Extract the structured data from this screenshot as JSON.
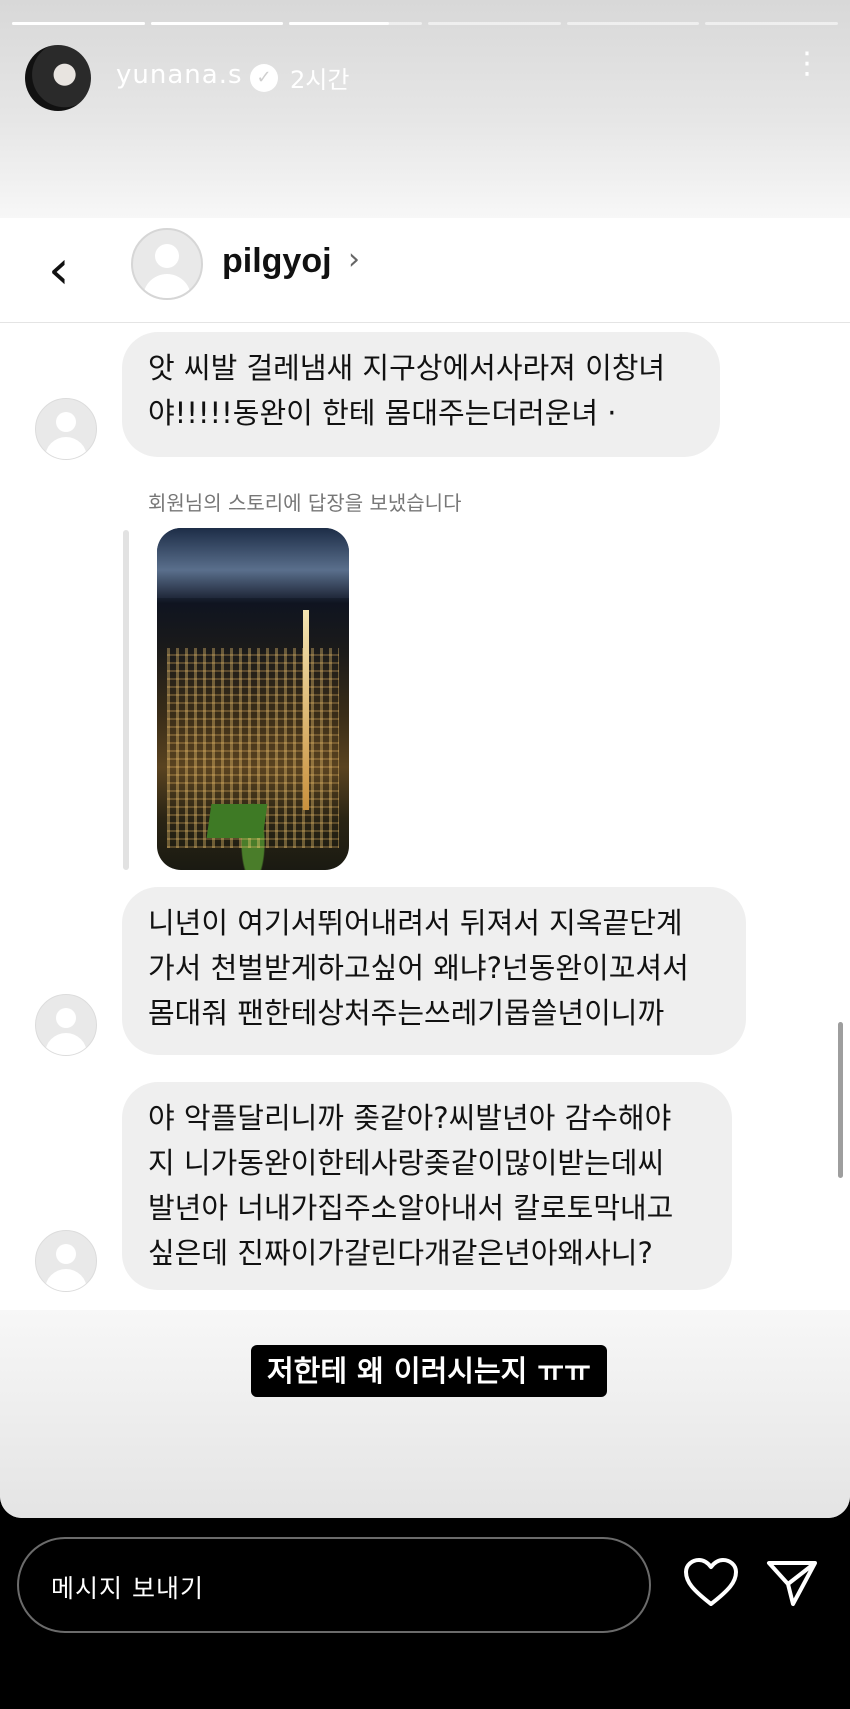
{
  "story": {
    "username": "yunana.s",
    "time": "2시간",
    "progress_segments": [
      1,
      1,
      0.75,
      0,
      0,
      0
    ],
    "caption": "저한테 왜 이러시는지 ㅠㅠ"
  },
  "dm": {
    "username": "pilgyoj",
    "messages": [
      {
        "lines": [
          "앗 씨발 걸레냄새 지구상에서사라져 이창녀",
          "야!!!!!동완이 한테 몸대주는더러운녀 ·"
        ]
      },
      {
        "reply_note": "회원님의 스토리에 답장을 보냈습니다"
      },
      {
        "lines": [
          "니년이 여기서뛰어내려서 뒤져서 지옥끝단계",
          "가서 천벌받게하고싶어 왜냐?넌동완이꼬셔서",
          "몸대줘 팬한테상처주는쓰레기몹쓸년이니까"
        ]
      },
      {
        "lines": [
          "야 악플달리니까 좆같아?씨발년아 감수해야",
          "지 니가동완이한테사랑좆같이많이받는데씨",
          "발년아 너내가집주소알아내서 칼로토막내고",
          "싶은데 진짜이가갈린다개같은년아왜사니?"
        ]
      }
    ]
  },
  "footer": {
    "message_placeholder": "메시지 보내기"
  },
  "icons": {
    "more": "kebab-menu-icon",
    "back": "chevron-left-icon",
    "heart": "heart-icon",
    "send": "send-icon"
  }
}
